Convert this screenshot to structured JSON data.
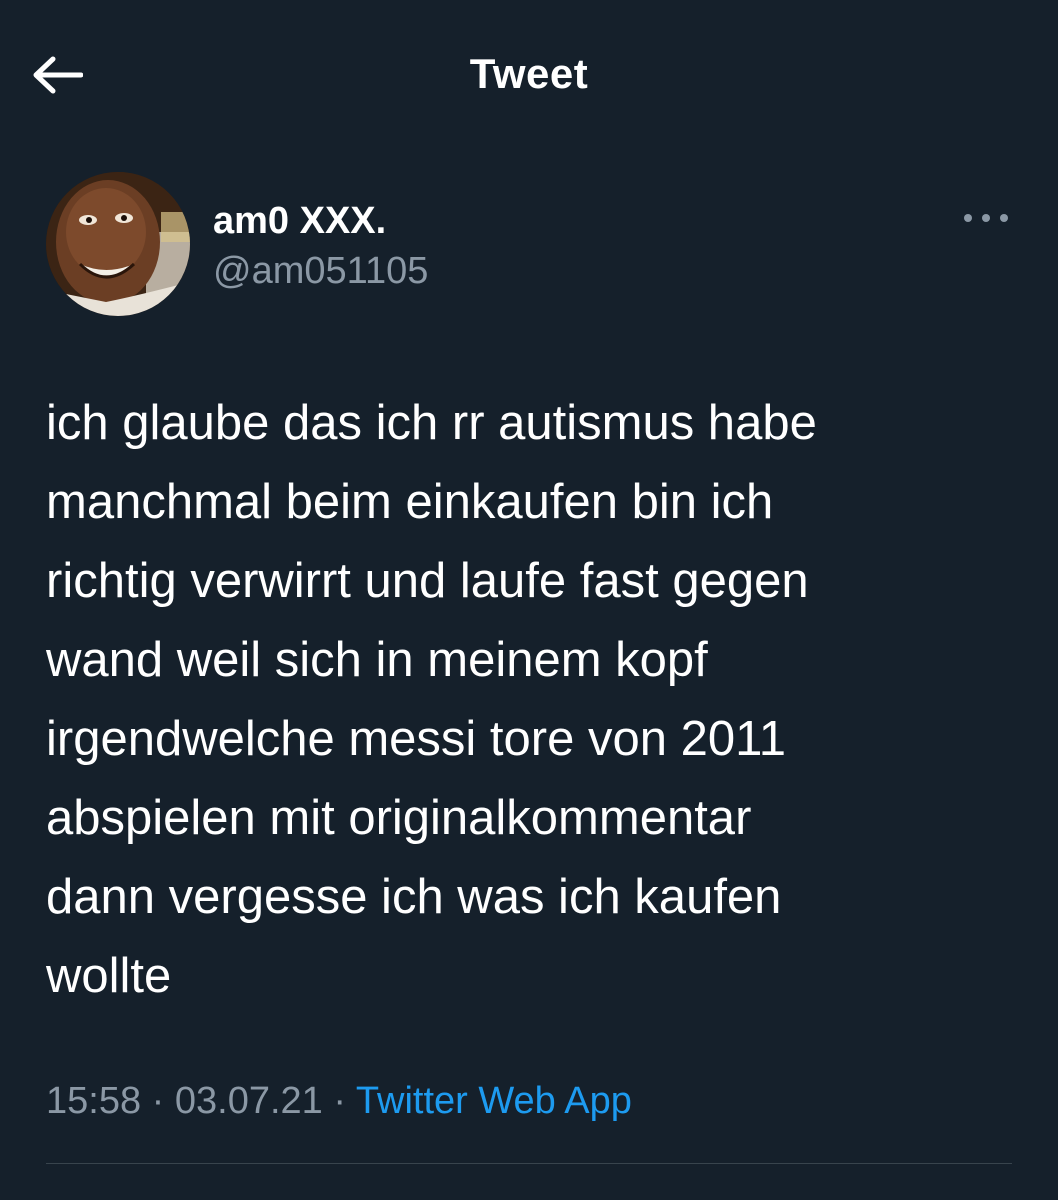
{
  "header": {
    "title": "Tweet",
    "back_icon": "arrow-left-icon"
  },
  "author": {
    "name": "am0 XXX.",
    "handle": "@am051105",
    "more_icon": "more-horizontal-icon"
  },
  "tweet": {
    "text": "ich glaube das ich rr autismus habe\nmanchmal beim einkaufen bin ich\nrichtig verwirrt und laufe fast gegen\nwand weil sich in meinem kopf\nirgendwelche messi tore von 2011\nabspielen mit originalkommentar\ndann vergesse ich was ich kaufen\nwollte"
  },
  "meta": {
    "time": "15:58",
    "separator": " · ",
    "date": "03.07.21",
    "source": "Twitter Web App"
  },
  "colors": {
    "background": "#15202b",
    "text_primary": "#ffffff",
    "text_secondary": "#8b98a5",
    "accent": "#1d9bf0",
    "divider": "#38444d"
  }
}
